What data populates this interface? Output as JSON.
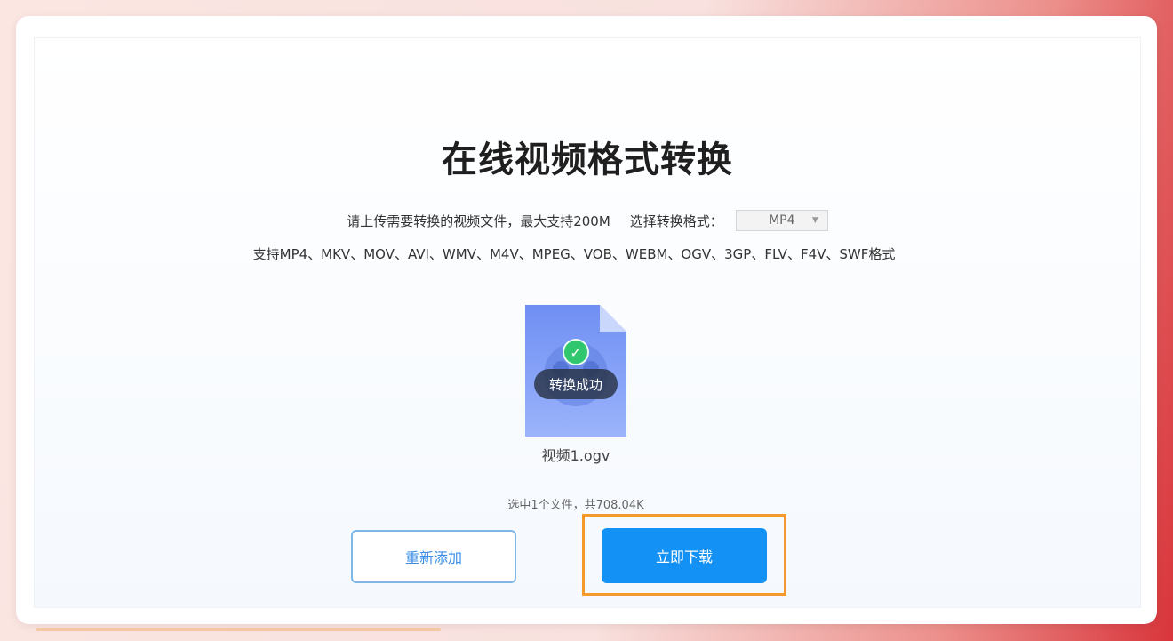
{
  "header": {
    "title": "在线视频格式转换"
  },
  "upload": {
    "hint": "请上传需要转换的视频文件，最大支持200M",
    "format_label": "选择转换格式：",
    "format_selected": "MP4",
    "supported_formats": "支持MP4、MKV、MOV、AVI、WMV、M4V、MPEG、VOB、WEBM、OGV、3GP、FLV、F4V、SWF格式"
  },
  "file": {
    "status": "转换成功",
    "name": "视频1.ogv",
    "summary": "选中1个文件，共708.04K"
  },
  "actions": {
    "readd_label": "重新添加",
    "download_label": "立即下载"
  },
  "colors": {
    "primary": "#1491f5",
    "success": "#2fc66d",
    "highlight": "#f39a2b",
    "file_icon": "#7f9ff5"
  }
}
